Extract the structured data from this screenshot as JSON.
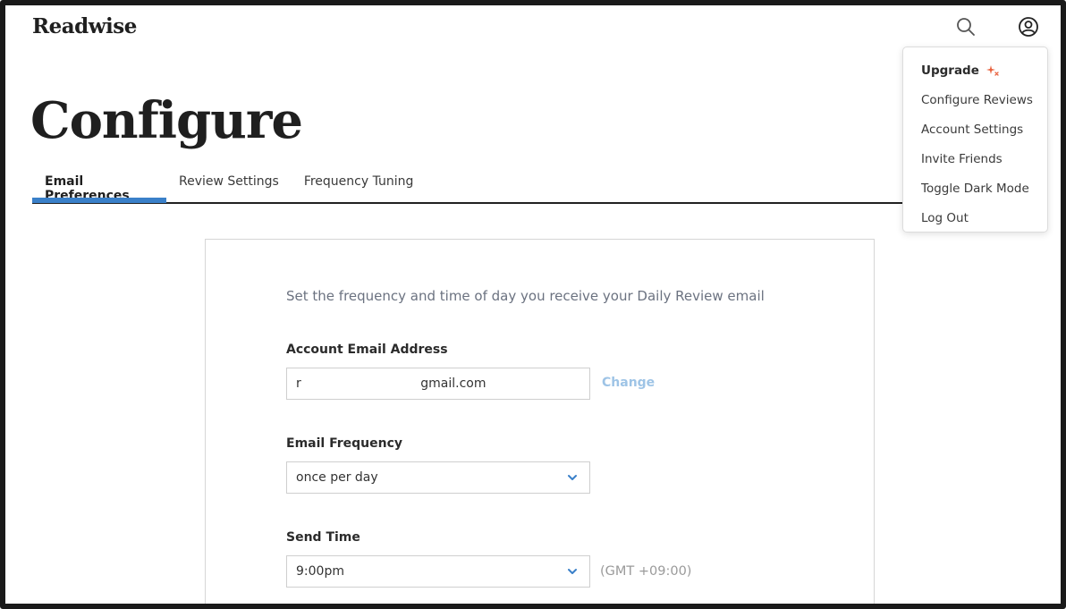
{
  "app": {
    "logo": "Readwise"
  },
  "header": {
    "search_icon": "search-icon",
    "account_icon": "user-circle-icon"
  },
  "page": {
    "title": "Configure"
  },
  "tabs": [
    {
      "label": "Email Preferences",
      "active": true
    },
    {
      "label": "Review Settings",
      "active": false
    },
    {
      "label": "Frequency Tuning",
      "active": false
    }
  ],
  "menu": {
    "items": [
      {
        "label": "Upgrade",
        "icon": "sparkle-icon"
      },
      {
        "label": "Configure Reviews"
      },
      {
        "label": "Account Settings"
      },
      {
        "label": "Invite Friends"
      },
      {
        "label": "Toggle Dark Mode"
      },
      {
        "label": "Log Out"
      }
    ]
  },
  "card": {
    "intro": "Set the frequency and time of day you receive your Daily Review email",
    "email": {
      "label": "Account Email Address",
      "value": "r                              gmail.com",
      "change": "Change"
    },
    "frequency": {
      "label": "Email Frequency",
      "value": "once per day"
    },
    "send_time": {
      "label": "Send Time",
      "value": "9:00pm",
      "timezone": "(GMT +09:00)"
    }
  },
  "colors": {
    "accent": "#3a80c9",
    "upgrade_sparkle": "#e8603c",
    "change_link": "#9ec4e6"
  }
}
